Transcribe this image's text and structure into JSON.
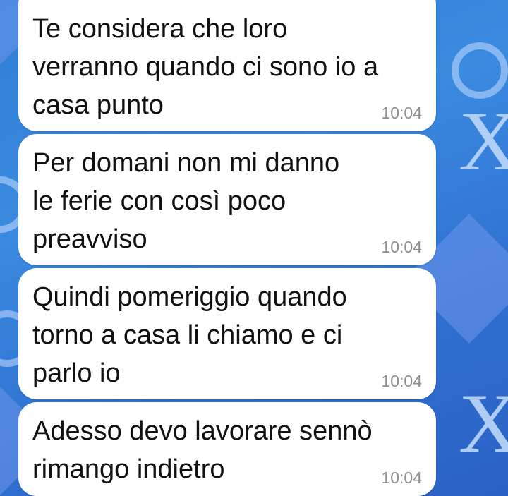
{
  "wallpaper": {
    "colors": {
      "base": "#2f7fd6",
      "shape": "#6e96eb",
      "accent": "#bed7fa"
    },
    "shapes": [
      "diamond",
      "x-letter",
      "flower"
    ]
  },
  "messages": [
    {
      "text": "Te considera che loro\nverranno quando ci sono io a\ncasa punto",
      "time": "10:04"
    },
    {
      "text": "Per domani non mi danno\nle ferie con così poco\npreavviso",
      "time": "10:04"
    },
    {
      "text": "Quindi pomeriggio quando\ntorno a casa li chiamo e ci\nparlo io",
      "time": "10:04"
    },
    {
      "text": "Adesso devo lavorare sennò\nrimango indietro",
      "time": "10:04"
    }
  ],
  "bubble_colors": {
    "background": "#ffffff",
    "text": "#111111",
    "time": "#8a8f94"
  }
}
